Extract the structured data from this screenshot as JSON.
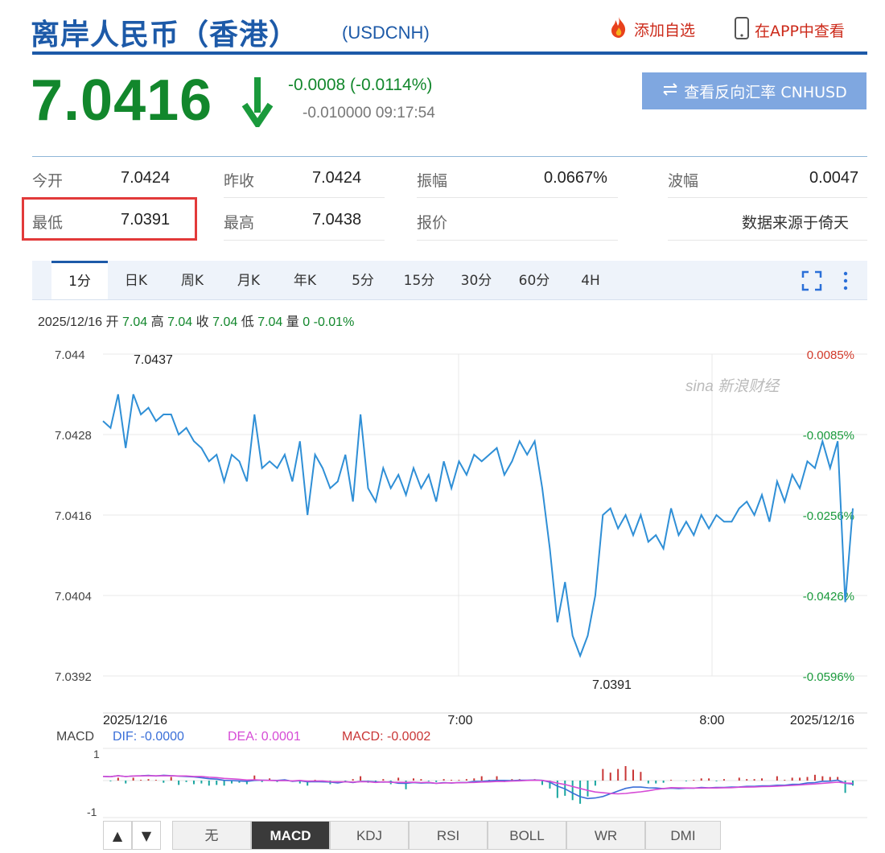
{
  "header": {
    "title": "离岸人民币（香港）",
    "code": "(USDCNH)",
    "add_fav_label": "添加自选",
    "app_label": "在APP中查看"
  },
  "quote": {
    "price": "7.0416",
    "change": "-0.0008 (-0.0114%)",
    "sub": "-0.010000 09:17:54",
    "reverse_label": "查看反向汇率 CNHUSD"
  },
  "stats": [
    [
      {
        "label": "今开",
        "value": "7.0424"
      },
      {
        "label": "昨收",
        "value": "7.0424"
      },
      {
        "label": "振幅",
        "value": "0.0667%"
      },
      {
        "label": "波幅",
        "value": "0.0047"
      }
    ],
    [
      {
        "label": "最低",
        "value": "7.0391"
      },
      {
        "label": "最高",
        "value": "7.0438"
      },
      {
        "label": "报价",
        "value": ""
      },
      {
        "label": "",
        "value": "数据来源于倚天"
      }
    ]
  ],
  "tabs": [
    "1分",
    "日K",
    "周K",
    "月K",
    "年K",
    "5分",
    "15分",
    "30分",
    "60分",
    "4H"
  ],
  "info": {
    "date": "2025/12/16",
    "open_label": "开",
    "open": "7.04",
    "high_label": "高",
    "high": "7.04",
    "close_label": "收",
    "close": "7.04",
    "low_label": "低",
    "low": "7.04",
    "vol_label": "量",
    "vol": "0",
    "pct": "-0.01%"
  },
  "watermark": "sina 新浪财经",
  "chart_data": {
    "type": "line",
    "series": [
      {
        "values": [
          7.043,
          7.0429,
          7.0434,
          7.0426,
          7.0434,
          7.0431,
          7.0432,
          7.043,
          7.0431,
          7.0431,
          7.0428,
          7.0429,
          7.0427,
          7.0426,
          7.0424,
          7.0425,
          7.0421,
          7.0425,
          7.0424,
          7.0421,
          7.0431,
          7.0423,
          7.0424,
          7.0423,
          7.0425,
          7.0421,
          7.0427,
          7.0416,
          7.0425,
          7.0423,
          7.042,
          7.0421,
          7.0425,
          7.0418,
          7.0431,
          7.042,
          7.0418,
          7.0423,
          7.042,
          7.0422,
          7.0419,
          7.0423,
          7.042,
          7.0422,
          7.0418,
          7.0424,
          7.042,
          7.0424,
          7.0422,
          7.0425,
          7.0424,
          7.0425,
          7.0426,
          7.0422,
          7.0424,
          7.0427,
          7.0425,
          7.0427,
          7.042,
          7.0411,
          7.04,
          7.0406,
          7.0398,
          7.0395,
          7.0398,
          7.0404,
          7.0416,
          7.0417,
          7.0414,
          7.0416,
          7.0413,
          7.0416,
          7.0412,
          7.0413,
          7.0411,
          7.0417,
          7.0413,
          7.0415,
          7.0413,
          7.0416,
          7.0414,
          7.0416,
          7.0415,
          7.0415,
          7.0417,
          7.0418,
          7.0416,
          7.0419,
          7.0415,
          7.0421,
          7.0418,
          7.0422,
          7.042,
          7.0424,
          7.0423,
          7.0427,
          7.0423,
          7.0427,
          7.0403,
          7.0417
        ]
      }
    ],
    "y_ticks": [
      "7.044",
      "7.0428",
      "7.0416",
      "7.0404",
      "7.0392"
    ],
    "y_range": [
      7.0392,
      7.044
    ],
    "pct_ticks": [
      "0.0085%",
      "-0.0085%",
      "-0.0256%",
      "-0.0426%",
      "-0.0596%"
    ],
    "x_labels": [
      "2025/12/16",
      "7:00",
      "8:00",
      "2025/12/16"
    ],
    "high_label": "7.0437",
    "low_label": "7.0391"
  },
  "macd": {
    "label": "MACD",
    "dif": "DIF: -0.0000",
    "dea": "DEA: 0.0001",
    "macd": "MACD: -0.0002",
    "axis_top": "1",
    "axis_bottom": "-1",
    "colors": {
      "dif": "#3a6fd8",
      "dea": "#d64bd6",
      "macd": "#c93636"
    }
  },
  "bottom_tabs": [
    "无",
    "MACD",
    "KDJ",
    "RSI",
    "BOLL",
    "WR",
    "DMI"
  ],
  "colors": {
    "accent": "#1d5aa8",
    "down": "#12872c",
    "up": "#cc2a1a",
    "line": "#2f8fd6"
  }
}
